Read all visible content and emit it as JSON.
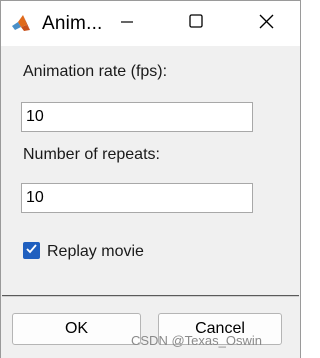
{
  "window": {
    "title": "Anim..."
  },
  "icons": {
    "app": "matlab-icon",
    "minimize": "minimize-icon",
    "maximize": "maximize-icon",
    "close": "close-icon",
    "check": "check-icon"
  },
  "form": {
    "rate_label": "Animation rate (fps):",
    "rate_value": "10",
    "repeats_label": "Number of repeats:",
    "repeats_value": "10",
    "replay_label": "Replay movie",
    "replay_checked": true
  },
  "buttons": {
    "ok_label": "OK",
    "cancel_label": "Cancel"
  },
  "watermark": "CSDN @Texas_Oswin",
  "colors": {
    "checkbox_accent": "#1f5fbf",
    "panel_bg": "#f0f0f0"
  }
}
